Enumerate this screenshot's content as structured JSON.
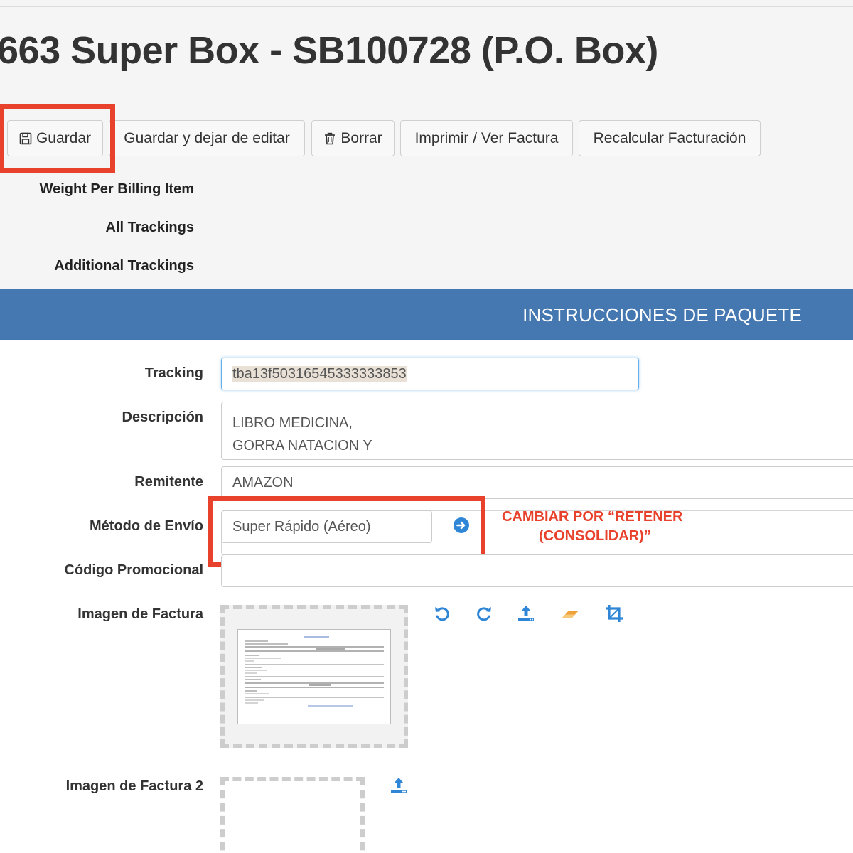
{
  "header": {
    "title": "663 Super Box - SB100728 (P.O. Box)"
  },
  "toolbar": {
    "save": "Guardar",
    "save_continue": "Guardar y dejar de editar",
    "delete": "Borrar",
    "print": "Imprimir / Ver Factura",
    "recalc": "Recalcular Facturación"
  },
  "meta": {
    "weight_per_billing_item": "Weight Per Billing Item",
    "all_trackings": "All Trackings",
    "additional_trackings": "Additional Trackings"
  },
  "banner": {
    "title": "INSTRUCCIONES DE PAQUETE"
  },
  "form": {
    "tracking": {
      "label": "Tracking",
      "value": "tba13f50316545333333853"
    },
    "descripcion": {
      "label": "Descripción",
      "lines": [
        "LIBRO MEDICINA,",
        "GORRA NATACION Y"
      ]
    },
    "remitente": {
      "label": "Remitente",
      "value": "AMAZON"
    },
    "metodo_envio": {
      "label": "Método de Envío",
      "value": "Super Rápido (Aéreo)"
    },
    "codigo_promocional": {
      "label": "Código Promocional",
      "value": ""
    },
    "imagen_factura": {
      "label": "Imagen de Factura"
    },
    "imagen_factura_2": {
      "label": "Imagen de Factura 2"
    }
  },
  "annotation": {
    "line1": "CAMBIAR POR “RETENER",
    "line2": "(CONSOLIDAR)”"
  },
  "icons": {
    "save": "floppy-disk-icon",
    "delete": "trash-icon",
    "go": "arrow-circle-right-icon",
    "rotate_left": "rotate-left-icon",
    "rotate_right": "rotate-right-icon",
    "upload": "upload-icon",
    "eraser": "eraser-icon",
    "crop": "crop-icon"
  },
  "colors": {
    "banner": "#4577b0",
    "annotation": "#e8412c",
    "tool_icon": "#2f86d6"
  }
}
